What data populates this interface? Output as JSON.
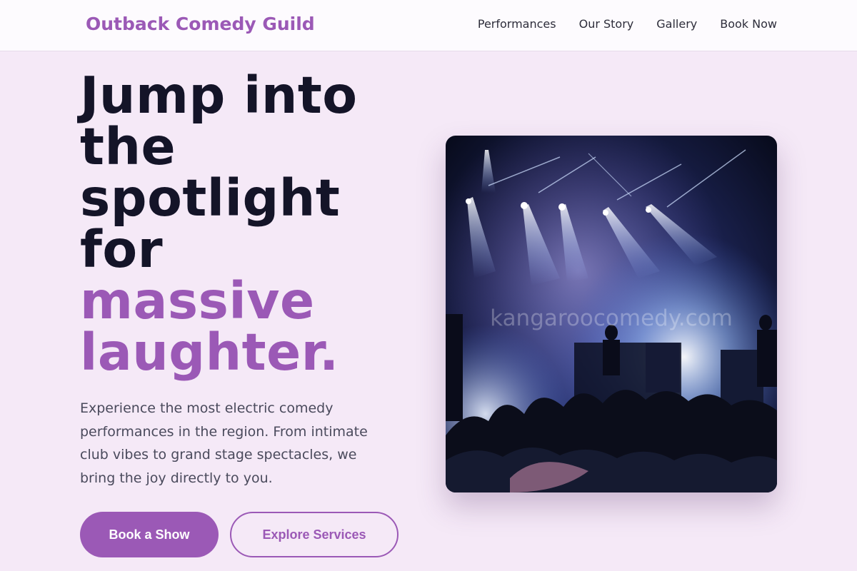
{
  "navbar": {
    "brand": "Outback Comedy Guild",
    "links": [
      "Performances",
      "Our Story",
      "Gallery",
      "Book Now"
    ]
  },
  "hero": {
    "headline_dark": [
      "Jump into",
      "the",
      "spotlight",
      "for"
    ],
    "headline_accent": [
      "massive",
      "laughter."
    ],
    "description": "Experience the most electric comedy performances in the region. From intimate club vibes to grand stage spectacles, we bring the joy directly to you.",
    "primary_button": "Book a Show",
    "secondary_button": "Explore Services",
    "image": {
      "alt": "concert-stage-photo",
      "watermark": "kangaroocomedy.com"
    }
  },
  "colors": {
    "accent": "#9b59b6",
    "background": "#f5e9f7",
    "headline": "#141428",
    "body_text": "#4a4a5c"
  }
}
